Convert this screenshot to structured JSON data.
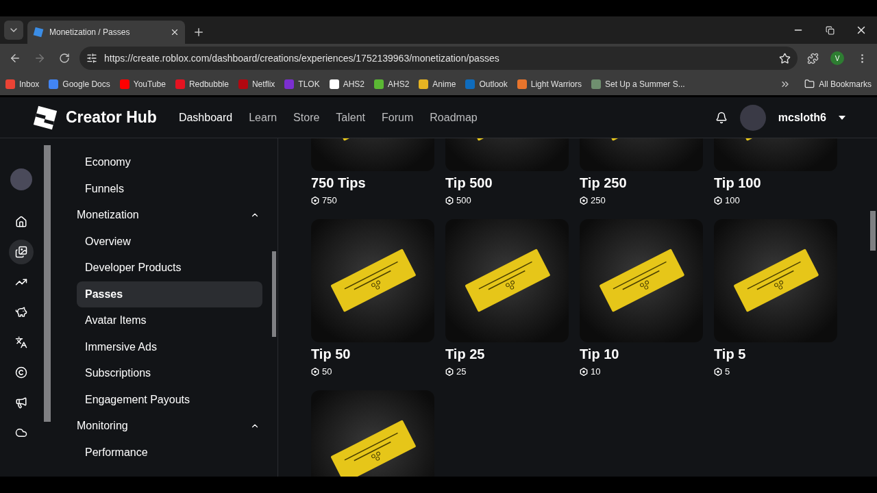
{
  "browser": {
    "tab": {
      "title": "Monetization / Passes"
    },
    "url": "https://create.roblox.com/dashboard/creations/experiences/1752139963/monetization/passes",
    "profile_initial": "V",
    "bookmarks": [
      {
        "label": "Inbox",
        "color": "#ea4335"
      },
      {
        "label": "Google Docs",
        "color": "#4285f4"
      },
      {
        "label": "YouTube",
        "color": "#ff0000"
      },
      {
        "label": "Redbubble",
        "color": "#e41321"
      },
      {
        "label": "Netflix",
        "color": "#b20710"
      },
      {
        "label": "TLOK",
        "color": "#7b2fd0"
      },
      {
        "label": "AHS2",
        "color": "#ffffff"
      },
      {
        "label": "AHS2",
        "color": "#5bb834"
      },
      {
        "label": "Anime",
        "color": "#e6b422"
      },
      {
        "label": "Outlook",
        "color": "#0f6cbd"
      },
      {
        "label": "Light Warriors",
        "color": "#e8742c"
      },
      {
        "label": "Set Up a Summer S...",
        "color": "#6f8f6f"
      }
    ],
    "all_bookmarks": "All Bookmarks"
  },
  "header": {
    "brand": "Creator Hub",
    "nav": [
      {
        "label": "Dashboard",
        "selected": true
      },
      {
        "label": "Learn",
        "selected": false
      },
      {
        "label": "Store",
        "selected": false
      },
      {
        "label": "Talent",
        "selected": false
      },
      {
        "label": "Forum",
        "selected": false
      },
      {
        "label": "Roadmap",
        "selected": false
      }
    ],
    "username": "mcsloth6"
  },
  "rail": [
    {
      "kind": "avatar",
      "selected": false
    },
    {
      "kind": "home",
      "selected": false
    },
    {
      "kind": "creations",
      "selected": true
    },
    {
      "kind": "analytics",
      "selected": false
    },
    {
      "kind": "monetization",
      "selected": false
    },
    {
      "kind": "translate",
      "selected": false
    },
    {
      "kind": "copyright",
      "selected": false
    },
    {
      "kind": "ads",
      "selected": false
    },
    {
      "kind": "cloud",
      "selected": false
    }
  ],
  "nav": [
    {
      "children": [
        {
          "label": "Economy",
          "selected": false
        },
        {
          "label": "Funnels",
          "selected": false
        }
      ]
    },
    {
      "label": "Monetization",
      "expanded": true,
      "children": [
        {
          "label": "Overview",
          "selected": false
        },
        {
          "label": "Developer Products",
          "selected": false
        },
        {
          "label": "Passes",
          "selected": true
        },
        {
          "label": "Avatar Items",
          "selected": false
        },
        {
          "label": "Immersive Ads",
          "selected": false
        },
        {
          "label": "Subscriptions",
          "selected": false
        },
        {
          "label": "Engagement Payouts",
          "selected": false
        }
      ]
    },
    {
      "label": "Monitoring",
      "expanded": true,
      "children": [
        {
          "label": "Performance",
          "selected": false
        }
      ]
    }
  ],
  "passes": [
    {
      "kind": "pass",
      "name": "750 Tips",
      "price": "750"
    },
    {
      "kind": "pass",
      "name": "Tip 500",
      "price": "500"
    },
    {
      "kind": "pass",
      "name": "Tip 250",
      "price": "250"
    },
    {
      "kind": "pass",
      "name": "Tip 100",
      "price": "100"
    },
    {
      "kind": "pass",
      "name": "Tip 50",
      "price": "50"
    },
    {
      "kind": "pass",
      "name": "Tip 25",
      "price": "25"
    },
    {
      "kind": "pass",
      "name": "Tip 10",
      "price": "10"
    },
    {
      "kind": "pass",
      "name": "Tip 5",
      "price": "5"
    },
    {
      "kind": "image"
    }
  ]
}
